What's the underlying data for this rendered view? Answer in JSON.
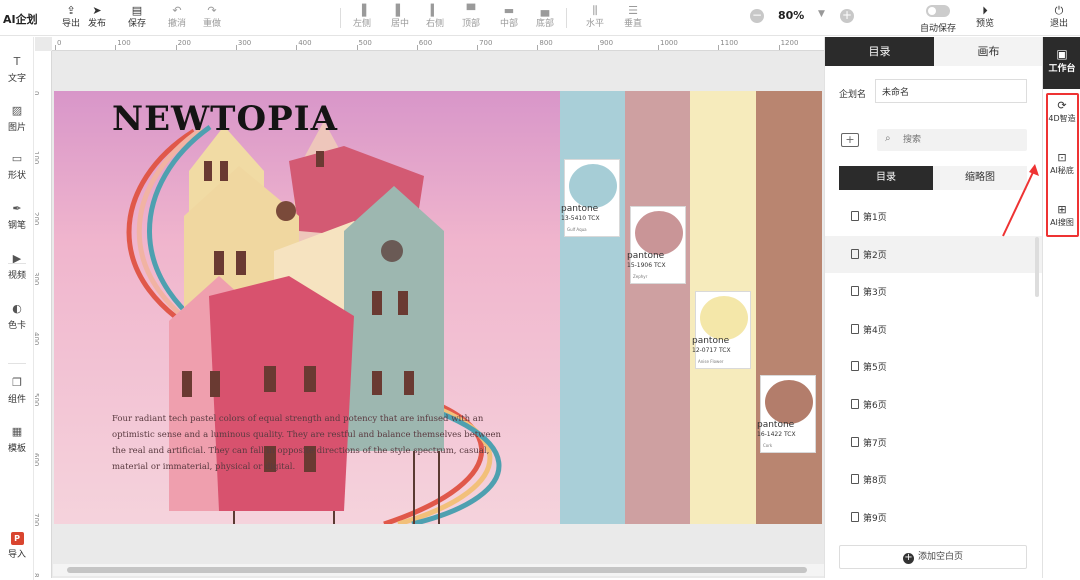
{
  "app": {
    "brand": "AI企划"
  },
  "toolbar": {
    "file": [
      {
        "label": "导出",
        "icon": "export-icon"
      },
      {
        "label": "发布",
        "icon": "send-icon"
      },
      {
        "label": "保存",
        "icon": "save-icon"
      },
      {
        "label": "撤消",
        "icon": "undo-icon"
      },
      {
        "label": "重做",
        "icon": "redo-icon"
      }
    ],
    "align": [
      {
        "label": "左侧",
        "icon": "align-left-icon"
      },
      {
        "label": "居中",
        "icon": "align-center-icon"
      },
      {
        "label": "右侧",
        "icon": "align-right-icon"
      },
      {
        "label": "顶部",
        "icon": "align-top-icon"
      },
      {
        "label": "中部",
        "icon": "align-middle-icon"
      },
      {
        "label": "底部",
        "icon": "align-bottom-icon"
      },
      {
        "label": "水平",
        "icon": "distribute-horizontal-icon"
      },
      {
        "label": "垂直",
        "icon": "distribute-vertical-icon"
      }
    ],
    "zoom": "80%",
    "autosave_label": "自动保存",
    "preview_label": "预览",
    "exit_label": "退出"
  },
  "left_sidebar": [
    {
      "label": "文字",
      "icon": "text-icon"
    },
    {
      "label": "图片",
      "icon": "image-icon"
    },
    {
      "label": "形状",
      "icon": "shape-icon"
    },
    {
      "label": "钢笔",
      "icon": "pen-icon"
    },
    {
      "label": "视频",
      "icon": "video-icon"
    },
    {
      "label": "色卡",
      "icon": "palette-icon"
    },
    {
      "label": "组件",
      "icon": "component-icon"
    },
    {
      "label": "模板",
      "icon": "template-icon"
    },
    {
      "label": "导入",
      "icon": "ppt-import-icon"
    }
  ],
  "rulers": {
    "top": [
      "0",
      "100",
      "200",
      "300",
      "400",
      "500",
      "600",
      "700",
      "800",
      "900",
      "1000",
      "1100",
      "1200"
    ],
    "left": [
      "0",
      "100",
      "200",
      "300",
      "400",
      "500",
      "600",
      "700",
      "800"
    ]
  },
  "canvas": {
    "title": "NEWTOPIA",
    "body_text": "Four radiant tech pastel colors of equal strength and potency that are infused with an optimistic sense and a luminous quality. They are restful and balance themselves between the real and artificial. They can fall in opposite directions of the style spectrum, casual, material or immaterial, physical or digital.",
    "swatches": [
      {
        "brand": "pantone",
        "code": "13-5410 TCX",
        "name": "Gulf Aqua",
        "color": "#a9cfd8",
        "card": "#a6cdd6"
      },
      {
        "brand": "pantone",
        "code": "15-1906 TCX",
        "name": "Zephyr",
        "color": "#cea0a1",
        "card": "#c99597"
      },
      {
        "brand": "pantone",
        "code": "12-0717 TCX",
        "name": "Anise Flower",
        "color": "#f6ebbc",
        "card": "#f4e7a9"
      },
      {
        "brand": "pantone",
        "code": "16-1422 TCX",
        "name": "Cork",
        "color": "#b98570",
        "card": "#b37d6b"
      }
    ]
  },
  "right_panel": {
    "tabs": [
      "目录",
      "画布"
    ],
    "active_tab": "目录",
    "plan_name_label": "企划名",
    "plan_name_value": "未命名",
    "search_placeholder": "搜索",
    "subtabs": [
      "目录",
      "缩略图"
    ],
    "pages": [
      "第1页",
      "第2页",
      "第3页",
      "第4页",
      "第5页",
      "第6页",
      "第7页",
      "第8页",
      "第9页"
    ],
    "selected_page": "第2页",
    "add_page_label": "添加空白页"
  },
  "dock": {
    "workspace_label": "工作台",
    "tools": [
      {
        "label": "4D智造",
        "icon": "4d-icon"
      },
      {
        "label": "AI秘底",
        "icon": "ai-base-icon"
      },
      {
        "label": "AI搜图",
        "icon": "ai-image-search-icon"
      }
    ]
  }
}
